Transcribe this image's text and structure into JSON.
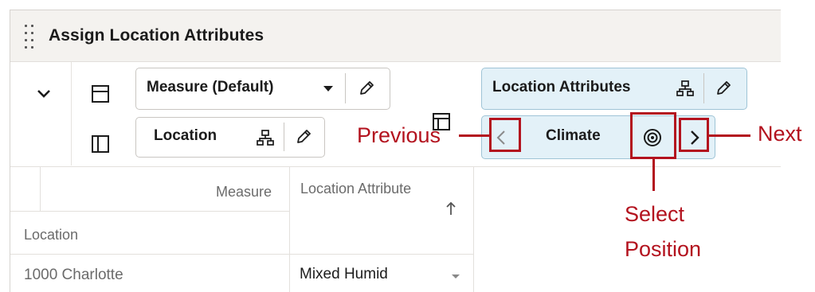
{
  "panel": {
    "title": "Assign Location Attributes"
  },
  "toolbar": {
    "measure_view": {
      "label": "Measure (Default)"
    },
    "location_view": {
      "label": "Location"
    },
    "attributes_view": {
      "label": "Location Attributes"
    },
    "position_selector": {
      "label": "Climate"
    }
  },
  "grid": {
    "corner_measure": "Measure",
    "column_header": "Location Attribute",
    "row_header": "Location",
    "rows": [
      {
        "location": "1000 Charlotte",
        "attribute": "Mixed Humid"
      }
    ]
  },
  "annotations": {
    "previous": "Previous",
    "next": "Next",
    "select_position_line1": "Select",
    "select_position_line2": "Position"
  },
  "colors": {
    "annotation_red": "#b3121e",
    "selector_blue": "#e3f1f8",
    "header_bg": "#f4f2ef"
  },
  "icons": [
    "drag-handle-icon",
    "chevron-down-icon",
    "layout-rows-icon",
    "layout-columns-icon",
    "layout-pivot-icon",
    "caret-down-icon",
    "pencil-icon",
    "hierarchy-icon",
    "chevron-left-icon",
    "chevron-right-icon",
    "target-icon",
    "sort-ascending-icon"
  ]
}
